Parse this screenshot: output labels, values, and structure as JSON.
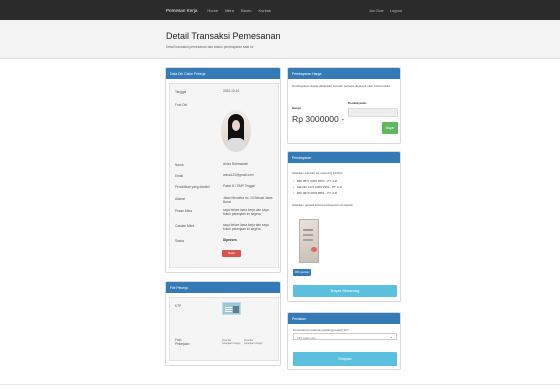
{
  "navbar": {
    "brand": "Pemesan Kerja",
    "links": [
      "Home",
      "Mitra",
      "Bantu",
      "Kontak"
    ],
    "right_links": [
      "Jon Doe",
      "Logout"
    ]
  },
  "header": {
    "title": "Detail Transaksi Pemesanan",
    "subtitle": "Detail transaksi pemesanan dan status pembayaran saat ini"
  },
  "customer_panel": {
    "title": "Data Diri Calon Pekerja",
    "fields": [
      {
        "label": "Tanggal",
        "value": "2020-10-10"
      },
      {
        "label": "Foto Diri",
        "value": ""
      },
      {
        "label": "Nama",
        "value": "Anisa Rahmawati"
      },
      {
        "label": "Email",
        "value": "anisa123@gmail.com"
      },
      {
        "label": "Pendidikan yang diambil",
        "value": "Paket B / SMP Tinggal"
      },
      {
        "label": "Alamat",
        "value": "Jalan Merdeka no. 10 Bekasi Jawa Barat"
      },
      {
        "label": "Pesan Mitra",
        "value": "saya belum lama kerja dan saya butuh pekerjaan ini segera"
      },
      {
        "label": "Catatan Mitra",
        "value": "saya belum lama kerja dan saya butuh pekerjaan ini segera"
      },
      {
        "label": "Status",
        "value": "Diproses"
      }
    ],
    "cancel_button": "Batal"
  },
  "file_panel": {
    "title": "File Pekerja",
    "ktp_label": "KTP",
    "photo_label": "Foto Pekerjaan",
    "image_alt_1": "[Gambar pekerjaan image]",
    "image_alt_2": "[Gambar pekerjaan image]"
  },
  "payment_panel": {
    "title": "Pembayaran Harga",
    "description": "Pembayaran dapat dilakukan setelah pekerja disetujui oleh mitra terkait",
    "price_label": "Harga",
    "price_value": "Rp 3000000 -",
    "voucher_label": "Pembayaran",
    "pay_button": "Bayar"
  },
  "transfer_panel": {
    "title": "Pembayaran",
    "intro": "Silahkan transfer ke rekening berikut:",
    "accounts": [
      "BRI 0871 0000 6554 - PT. A.D",
      "Mandiri 1470 0000 9552 - PT. A.D",
      "BNI 0870 0000 8891 - PT. A.D"
    ],
    "upload_note": "Silahkan upload bukti pembayaran di bawah",
    "upload_button": "Pilih gambar",
    "pay_now_button": "Bayar Sekarang"
  },
  "rating_panel": {
    "title": "Penilaian",
    "question": "Pemesanan pekerja (sedang pesan) ini?",
    "select_placeholder": "Pilih salah satu",
    "submit_button": "Simpan"
  },
  "colors": {
    "panel_heading": "#337ab7",
    "navbar": "#2b2b2b",
    "danger": "#d9534f",
    "success": "#5cb85c",
    "info": "#5bc0de"
  }
}
